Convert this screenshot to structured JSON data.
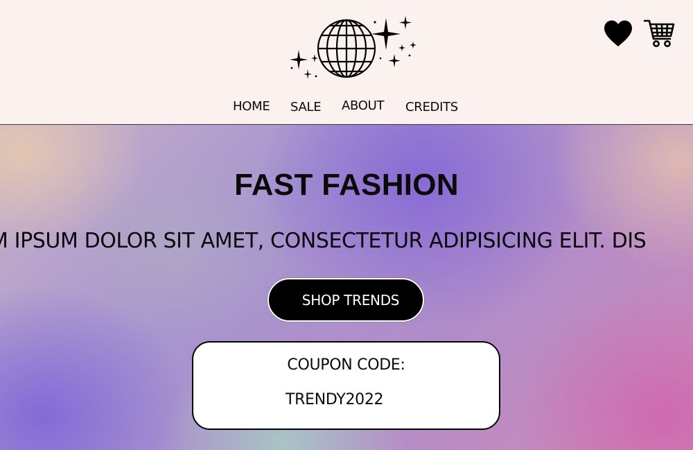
{
  "header": {
    "logo_icon": "disco-globe-sparkles-icon",
    "icons": {
      "favorites": "heart-icon",
      "cart": "shopping-cart-icon"
    },
    "nav": {
      "home": "HOME",
      "sale": "SALE",
      "about": "ABOUT",
      "credits": "CREDITS"
    }
  },
  "hero": {
    "title": "FAST FASHION",
    "marquee_text": "M IPSUM DOLOR SIT AMET, CONSECTETUR ADIPISICING ELIT. DIS",
    "shop_button": "SHOP TRENDS",
    "coupon": {
      "label": "COUPON CODE:",
      "code": "TRENDY2022"
    }
  },
  "colors": {
    "header_bg": "#fbf1ef",
    "button_bg": "#000000",
    "text": "#0a0a0a",
    "gradient": [
      "#e4c8b2",
      "#8668d6",
      "#8068d8",
      "#ce68b0",
      "#a8cec4"
    ]
  }
}
